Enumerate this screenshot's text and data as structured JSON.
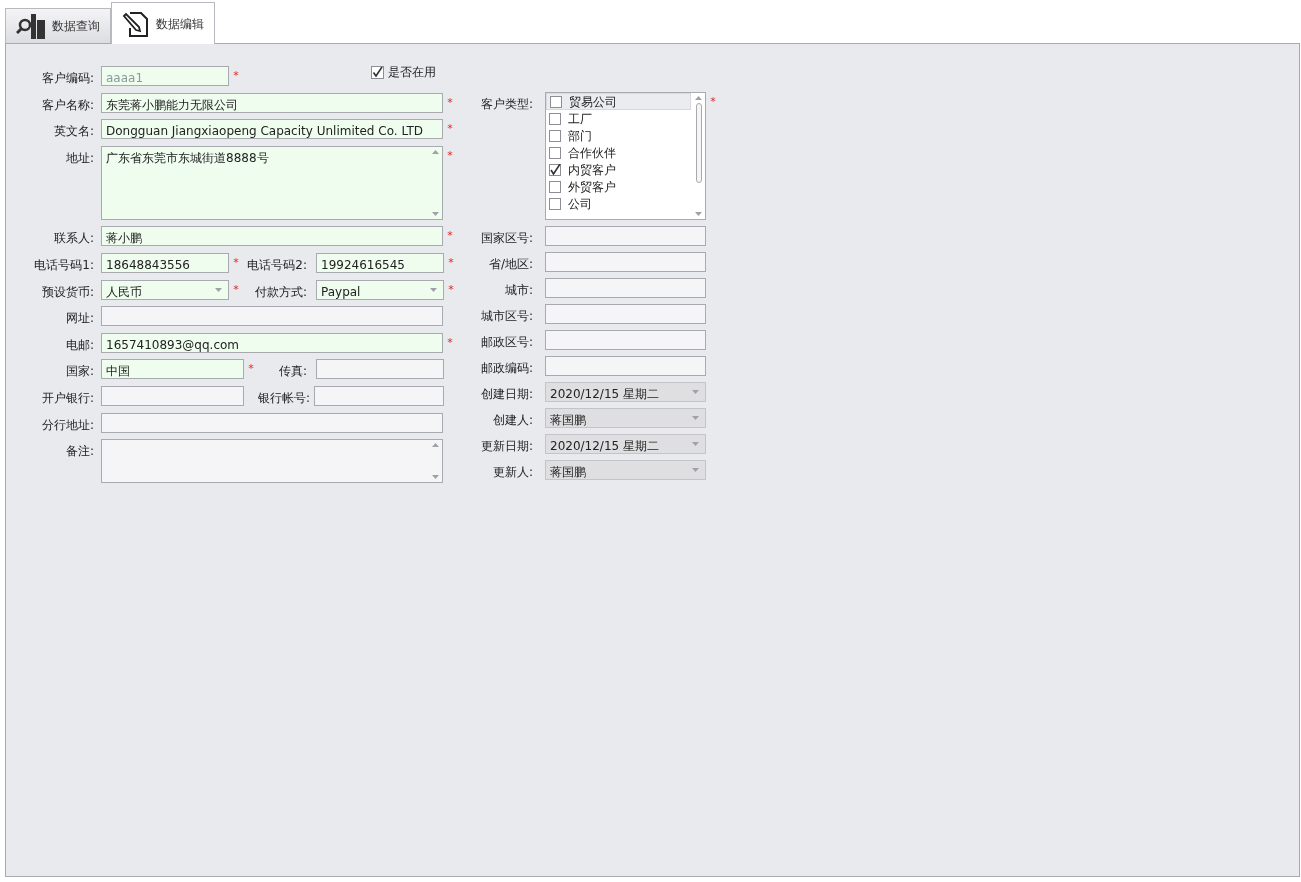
{
  "tabs": [
    {
      "label": "数据查询",
      "selected": false
    },
    {
      "label": "数据编辑",
      "selected": true
    }
  ],
  "active_checkbox": {
    "label": "是否在用",
    "checked": true
  },
  "left_fields": [
    {
      "kind": "short",
      "label": "客户编码:",
      "value": "aaaa1",
      "mark": "*",
      "readonly": true
    },
    {
      "kind": "text",
      "label": "客户名称:",
      "value": "东莞蒋小鹏能力无限公司",
      "mark": "*"
    },
    {
      "kind": "text",
      "label": "英文名:",
      "value": "Dongguan Jiangxiaopeng Capacity Unlimited Co. LTD",
      "mark": "*"
    },
    {
      "kind": "memo",
      "label": "地址:",
      "value": "广东省东莞市东城街道8888号",
      "mark": "*"
    },
    {
      "kind": "text",
      "label": "联系人:",
      "value": "蒋小鹏",
      "mark": "*"
    },
    {
      "kind": "pair",
      "label": "电话号码1:",
      "value": "18648843556",
      "mark": "*",
      "label2": "电话号码2:",
      "value2": "19924616545",
      "mark2": "*"
    },
    {
      "kind": "combo-pair",
      "label": "预设货币:",
      "value": "人民币",
      "mark": "*",
      "label2": "付款方式:",
      "value2": "Paypal",
      "mark2": "*"
    },
    {
      "kind": "text",
      "label": "网址:"
    },
    {
      "kind": "text",
      "label": "电邮:",
      "value": "1657410893@qq.com",
      "mark": "*"
    },
    {
      "kind": "pair",
      "label": "国家:",
      "value": "中国",
      "mark": "*",
      "label2": "传真:"
    },
    {
      "kind": "pair",
      "label": "开户银行:",
      "label2": "银行帐号:"
    },
    {
      "kind": "text",
      "label": "分行地址:"
    },
    {
      "kind": "memo",
      "label": "备注:"
    }
  ],
  "customer_type": {
    "label": "客户类型:",
    "mark": "*",
    "items": [
      {
        "label": "贸易公司",
        "checked": false,
        "selected": true
      },
      {
        "label": "工厂",
        "checked": false,
        "selected": false
      },
      {
        "label": "部门",
        "checked": false,
        "selected": false
      },
      {
        "label": "合作伙伴",
        "checked": false,
        "selected": false
      },
      {
        "label": "内贸客户",
        "checked": true,
        "selected": false
      },
      {
        "label": "外贸客户",
        "checked": false,
        "selected": false
      },
      {
        "label": "公司",
        "checked": false,
        "selected": false
      }
    ]
  },
  "right_fields": [
    {
      "kind": "text",
      "label": "国家区号:",
      "disabled": false
    },
    {
      "kind": "text",
      "label": "省/地区:",
      "disabled": false
    },
    {
      "kind": "text",
      "label": "城市:",
      "disabled": false
    },
    {
      "kind": "text",
      "label": "城市区号:",
      "disabled": false
    },
    {
      "kind": "text",
      "label": "邮政区号:",
      "disabled": false
    },
    {
      "kind": "text",
      "label": "邮政编码:",
      "disabled": false
    },
    {
      "kind": "combo",
      "label": "创建日期:",
      "value": "2020/12/15 星期二",
      "disabled": true
    },
    {
      "kind": "combo",
      "label": "创建人:",
      "value": "蒋国鹏",
      "disabled": true
    },
    {
      "kind": "combo",
      "label": "更新日期:",
      "value": "2020/12/15 星期二",
      "disabled": true
    },
    {
      "kind": "combo",
      "label": "更新人:",
      "value": "蒋国鹏",
      "disabled": true
    }
  ]
}
